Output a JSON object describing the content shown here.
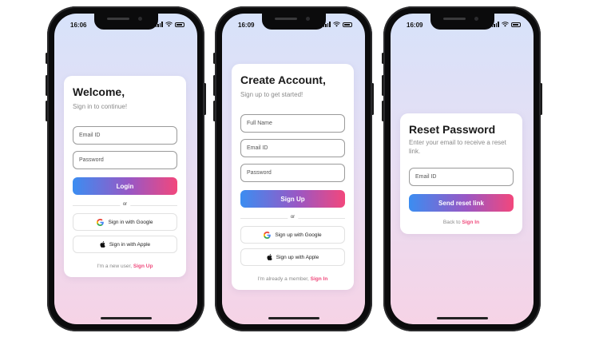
{
  "phones": [
    {
      "status_time": "16:06",
      "title": "Welcome,",
      "subtitle": "Sign in to continue!",
      "fields": [
        {
          "placeholder": "Email ID"
        },
        {
          "placeholder": "Password"
        }
      ],
      "primary_label": "Login",
      "or_label": "or",
      "google_label": "Sign in with Google",
      "apple_label": "Sign in with Apple",
      "footer_text": "I'm a new user,",
      "footer_link": "Sign Up"
    },
    {
      "status_time": "16:09",
      "title": "Create Account,",
      "subtitle": "Sign up to get started!",
      "fields": [
        {
          "placeholder": "Full Name"
        },
        {
          "placeholder": "Email ID"
        },
        {
          "placeholder": "Password"
        }
      ],
      "primary_label": "Sign Up",
      "or_label": "or",
      "google_label": "Sign up with Google",
      "apple_label": "Sign up with Apple",
      "footer_text": "I'm already a member,",
      "footer_link": "Sign In"
    },
    {
      "status_time": "16:09",
      "title": "Reset Password",
      "subtitle": "Enter your email to receive a reset link.",
      "fields": [
        {
          "placeholder": "Email ID"
        }
      ],
      "primary_label": "Send reset link",
      "footer_text": "Back to",
      "footer_link": "Sign In"
    }
  ],
  "colors": {
    "gradient_start": "#3b8df1",
    "gradient_end": "#f2477c",
    "link": "#ef4a7c"
  },
  "icons": {
    "google": "google-icon",
    "apple": "apple-icon"
  }
}
